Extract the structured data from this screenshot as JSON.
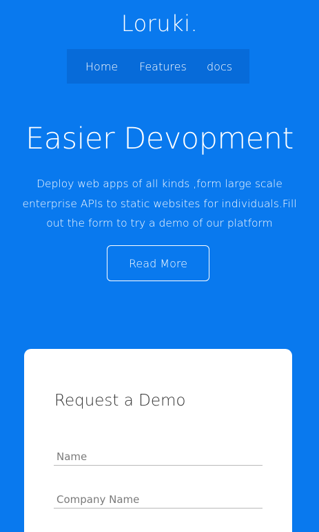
{
  "brand": {
    "logo": "Loruki."
  },
  "nav": {
    "items": [
      "Home",
      "Features",
      "docs"
    ]
  },
  "hero": {
    "title": "Easier Devopment",
    "text": "Deploy web apps of all kinds ,form large scale enterprise APIs to static websites for individuals.Fill out the form to try a demo of our platform",
    "button_label": "Read More"
  },
  "form": {
    "title": "Request a Demo",
    "name_placeholder": "Name",
    "company_placeholder": "Company Name"
  },
  "colors": {
    "background": "#0979ee",
    "nav_bg": "#076bd9",
    "card_bg": "#ffffff"
  }
}
